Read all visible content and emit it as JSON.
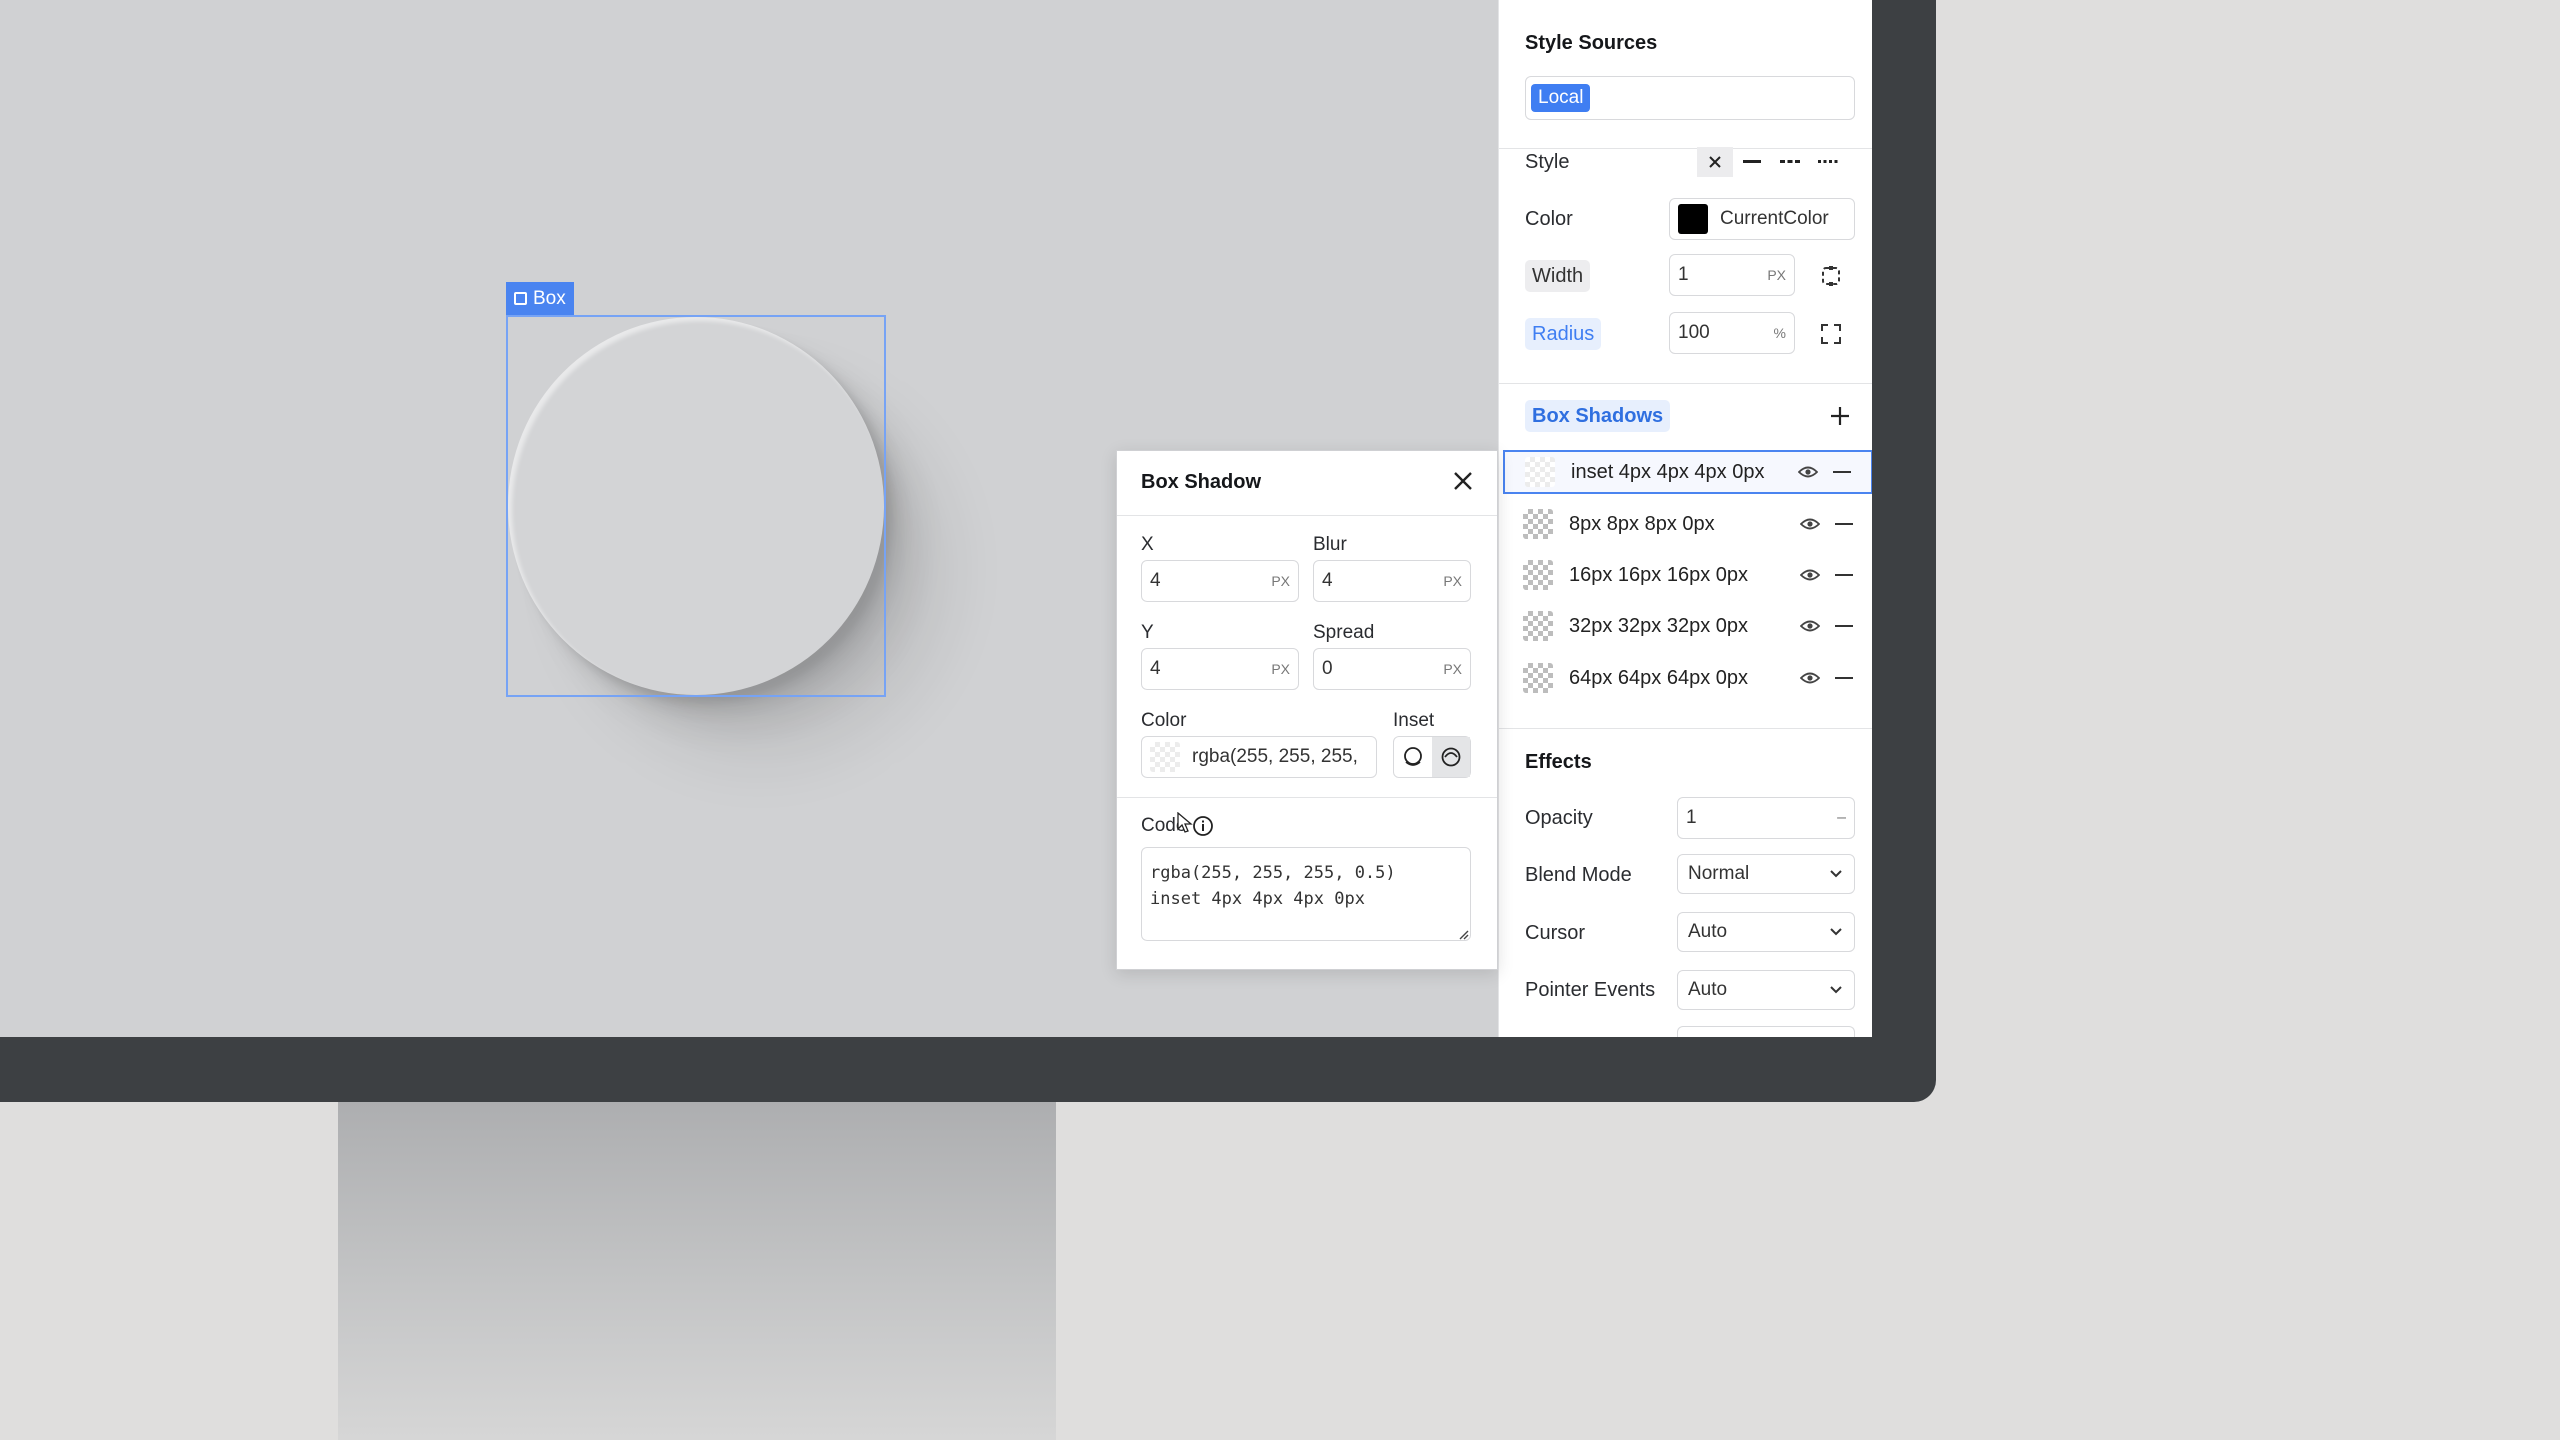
{
  "canvas": {
    "selection_label": "Box"
  },
  "panel": {
    "style_sources": {
      "title": "Style Sources",
      "token": "Local"
    },
    "border": {
      "style_label": "Style",
      "color_label": "Color",
      "color_value": "CurrentColor",
      "color_swatch": "#000000",
      "width_label": "Width",
      "width_value": "1",
      "width_unit": "PX",
      "radius_label": "Radius",
      "radius_value": "100",
      "radius_unit": "%"
    },
    "box_shadows": {
      "title": "Box Shadows",
      "items": [
        {
          "label": "inset 4px 4px 4px 0px"
        },
        {
          "label": "8px 8px 8px 0px"
        },
        {
          "label": "16px 16px 16px 0px"
        },
        {
          "label": "32px 32px 32px 0px"
        },
        {
          "label": "64px 64px 64px 0px"
        }
      ]
    },
    "effects": {
      "title": "Effects",
      "opacity_label": "Opacity",
      "opacity_value": "1",
      "blend_label": "Blend Mode",
      "blend_value": "Normal",
      "cursor_label": "Cursor",
      "cursor_value": "Auto",
      "pointer_label": "Pointer Events",
      "pointer_value": "Auto"
    }
  },
  "dialog": {
    "title": "Box Shadow",
    "x_label": "X",
    "x_value": "4",
    "blur_label": "Blur",
    "blur_value": "4",
    "y_label": "Y",
    "y_value": "4",
    "spread_label": "Spread",
    "spread_value": "0",
    "unit": "PX",
    "color_label": "Color",
    "color_value": "rgba(255, 255, 255,",
    "inset_label": "Inset",
    "code_label": "Code",
    "code_value": "rgba(255, 255, 255, 0.5)\ninset 4px 4px 4px 0px"
  },
  "colors": {
    "accent": "#4a84f0",
    "bezel": "#3d4043",
    "canvas": "#d0d1d3"
  }
}
